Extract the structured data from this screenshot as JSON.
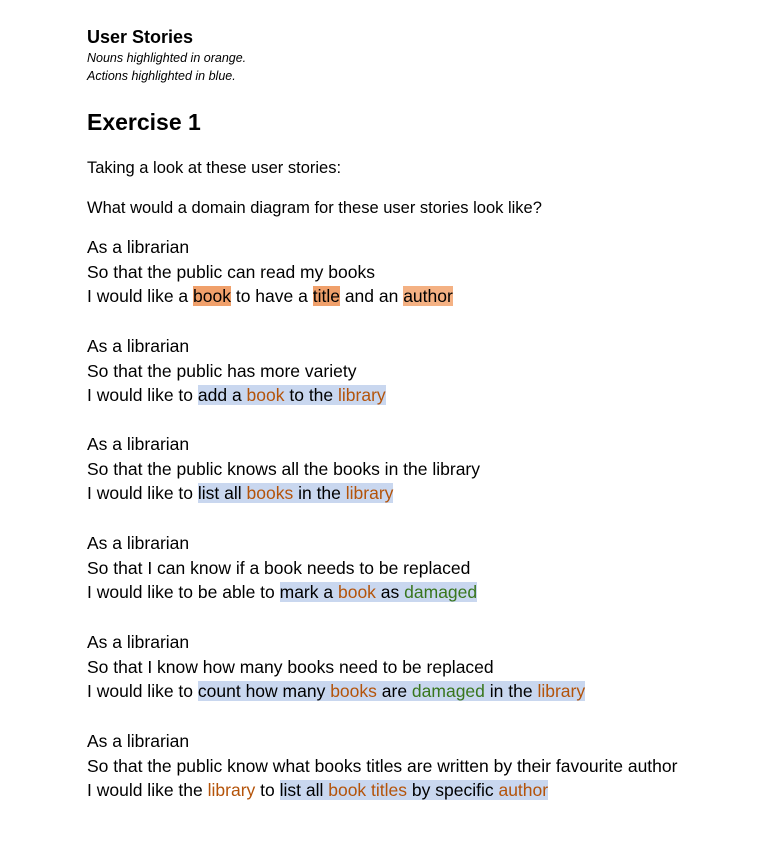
{
  "header": {
    "title": "User Stories",
    "note_nouns": "Nouns highlighted in orange.",
    "note_actions": "Actions highlighted in blue."
  },
  "exercise": {
    "heading": "Exercise 1",
    "intro1": "Taking a look at these user stories:",
    "intro2": "What would a domain diagram for these user stories look like?"
  },
  "stories": [
    {
      "role": "As a librarian",
      "goal": "So that the public can read my books",
      "want": {
        "p1": "I would like a ",
        "n1": "book",
        "p2": " to have a ",
        "n2": "title",
        "p3": " and an ",
        "n3": "author"
      }
    },
    {
      "role": "As a librarian",
      "goal": "So that the public has more variety",
      "want": {
        "p1": "I would like to ",
        "a1": "add a ",
        "n1": "book",
        "a2": " to the ",
        "n2": "library"
      }
    },
    {
      "role": "As a librarian",
      "goal": "So that the public knows all the books in the library",
      "want": {
        "p1": "I would like to ",
        "a1": "list all ",
        "n1": "books",
        "a2": " in the ",
        "n2": "library"
      }
    },
    {
      "role": "As a librarian",
      "goal": "So that I can know if a book needs to be replaced",
      "want": {
        "p1": "I would like to be able to ",
        "a1": "mark a ",
        "n1": "book",
        "a2": " as ",
        "adj1": "damaged"
      }
    },
    {
      "role": "As a librarian",
      "goal": "So that I know how many books need to be replaced",
      "want": {
        "p1": "I would like to ",
        "a1": "count how many ",
        "n1": "books",
        "a2": " are ",
        "adj1": "damaged",
        "a3": " in the ",
        "n2": "library"
      }
    },
    {
      "role": "As a librarian",
      "goal": "So that the public know what books titles are written by their favourite author",
      "want": {
        "p1": "I would like the ",
        "n1": "library",
        "p2": " to ",
        "a1": "list all ",
        "n2": "book titles",
        "a2": " by specific ",
        "n3": "author"
      }
    }
  ],
  "colors": {
    "noun": "#b4501a",
    "noun_highlight": "#f4b183",
    "action_highlight": "#c9d7ef",
    "adjective": "#38761d"
  }
}
